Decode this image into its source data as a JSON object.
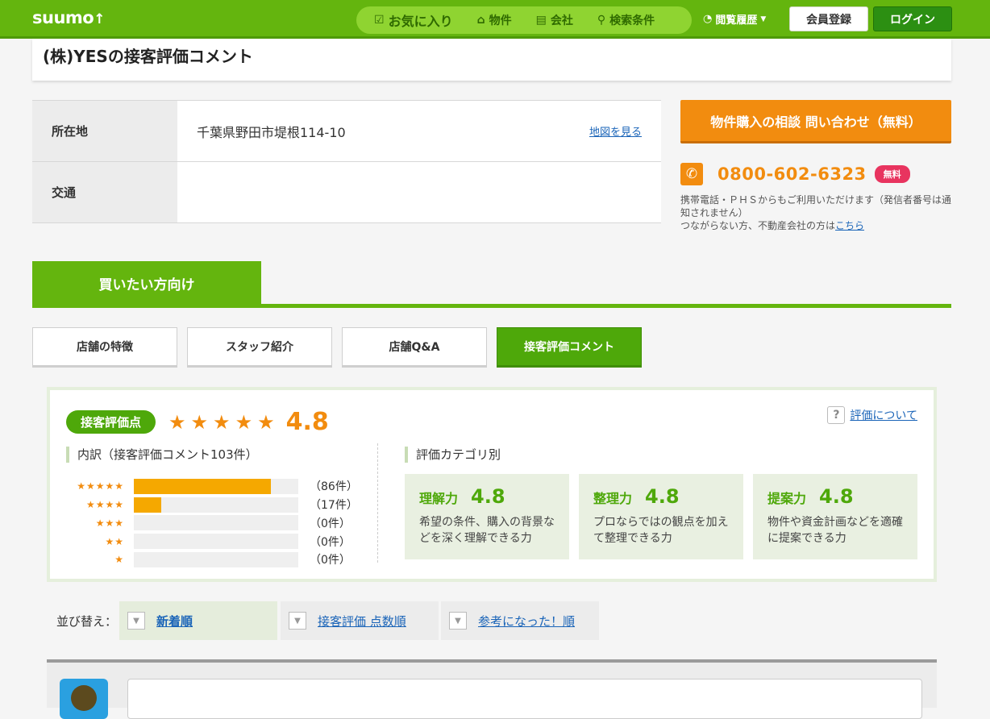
{
  "header": {
    "logo": "suumo",
    "logo_mark": "↑",
    "nav": [
      {
        "icon": "heart-note-icon",
        "glyph": "☑",
        "label": "お気に入り"
      },
      {
        "icon": "house-icon",
        "glyph": "⌂",
        "label": "物件"
      },
      {
        "icon": "building-icon",
        "glyph": "▤",
        "label": "会社"
      },
      {
        "icon": "search-icon",
        "glyph": "⚲",
        "label": "検索条件"
      }
    ],
    "history_label": "閲覧履歴",
    "history_caret": "▼",
    "register_label": "会員登録",
    "login_label": "ログイン"
  },
  "page": {
    "title": "(株)YESの接客評価コメント"
  },
  "info": {
    "rows": [
      {
        "label": "所在地",
        "value": "千葉県野田市堤根114-10",
        "link": "地図を見る"
      },
      {
        "label": "交通",
        "value": "",
        "link": ""
      }
    ]
  },
  "contact": {
    "inquiry_label": "物件購入の相談 問い合わせ（無料）",
    "phone_icon_glyph": "✆",
    "phone_number": "0800-602-6323",
    "free_badge": "無料",
    "note_line1": "携帯電話・ＰＨＳからもご利用いただけます（発信者番号は通知されません）",
    "note_line2_prefix": "つながらない方、不動産会社の方は",
    "note_line2_link": "こちら"
  },
  "tabs": {
    "main_label": "買いたい方向け",
    "sub": [
      "店舗の特徴",
      "スタッフ紹介",
      "店舗Q&A",
      "接客評価コメント"
    ],
    "active_index": 3
  },
  "rating": {
    "pill_label": "接客評価点",
    "stars_glyph": "★★★★★",
    "score": "4.8",
    "about_icon": "?",
    "about_label": "評価について",
    "breakdown_label": "内訳（接客評価コメント103件）",
    "breakdown": [
      {
        "stars": "★★★★★",
        "count_label": "（86件）",
        "ratio": 0.835
      },
      {
        "stars": "★★★★",
        "count_label": "（17件）",
        "ratio": 0.165
      },
      {
        "stars": "★★★",
        "count_label": "（0件）",
        "ratio": 0
      },
      {
        "stars": "★★",
        "count_label": "（0件）",
        "ratio": 0
      },
      {
        "stars": "★",
        "count_label": "（0件）",
        "ratio": 0
      }
    ],
    "category_label": "評価カテゴリ別",
    "categories": [
      {
        "name": "理解力",
        "score": "4.8",
        "desc": "希望の条件、購入の背景などを深く理解できる力"
      },
      {
        "name": "整理力",
        "score": "4.8",
        "desc": "プロならではの観点を加えて整理できる力"
      },
      {
        "name": "提案力",
        "score": "4.8",
        "desc": "物件や資金計画などを適確に提案できる力"
      }
    ]
  },
  "sort": {
    "label": "並び替え：",
    "check_glyph": "▼",
    "options": [
      "新着順",
      "接客評価 点数順",
      "参考になった！順"
    ],
    "active_index": 0
  }
}
